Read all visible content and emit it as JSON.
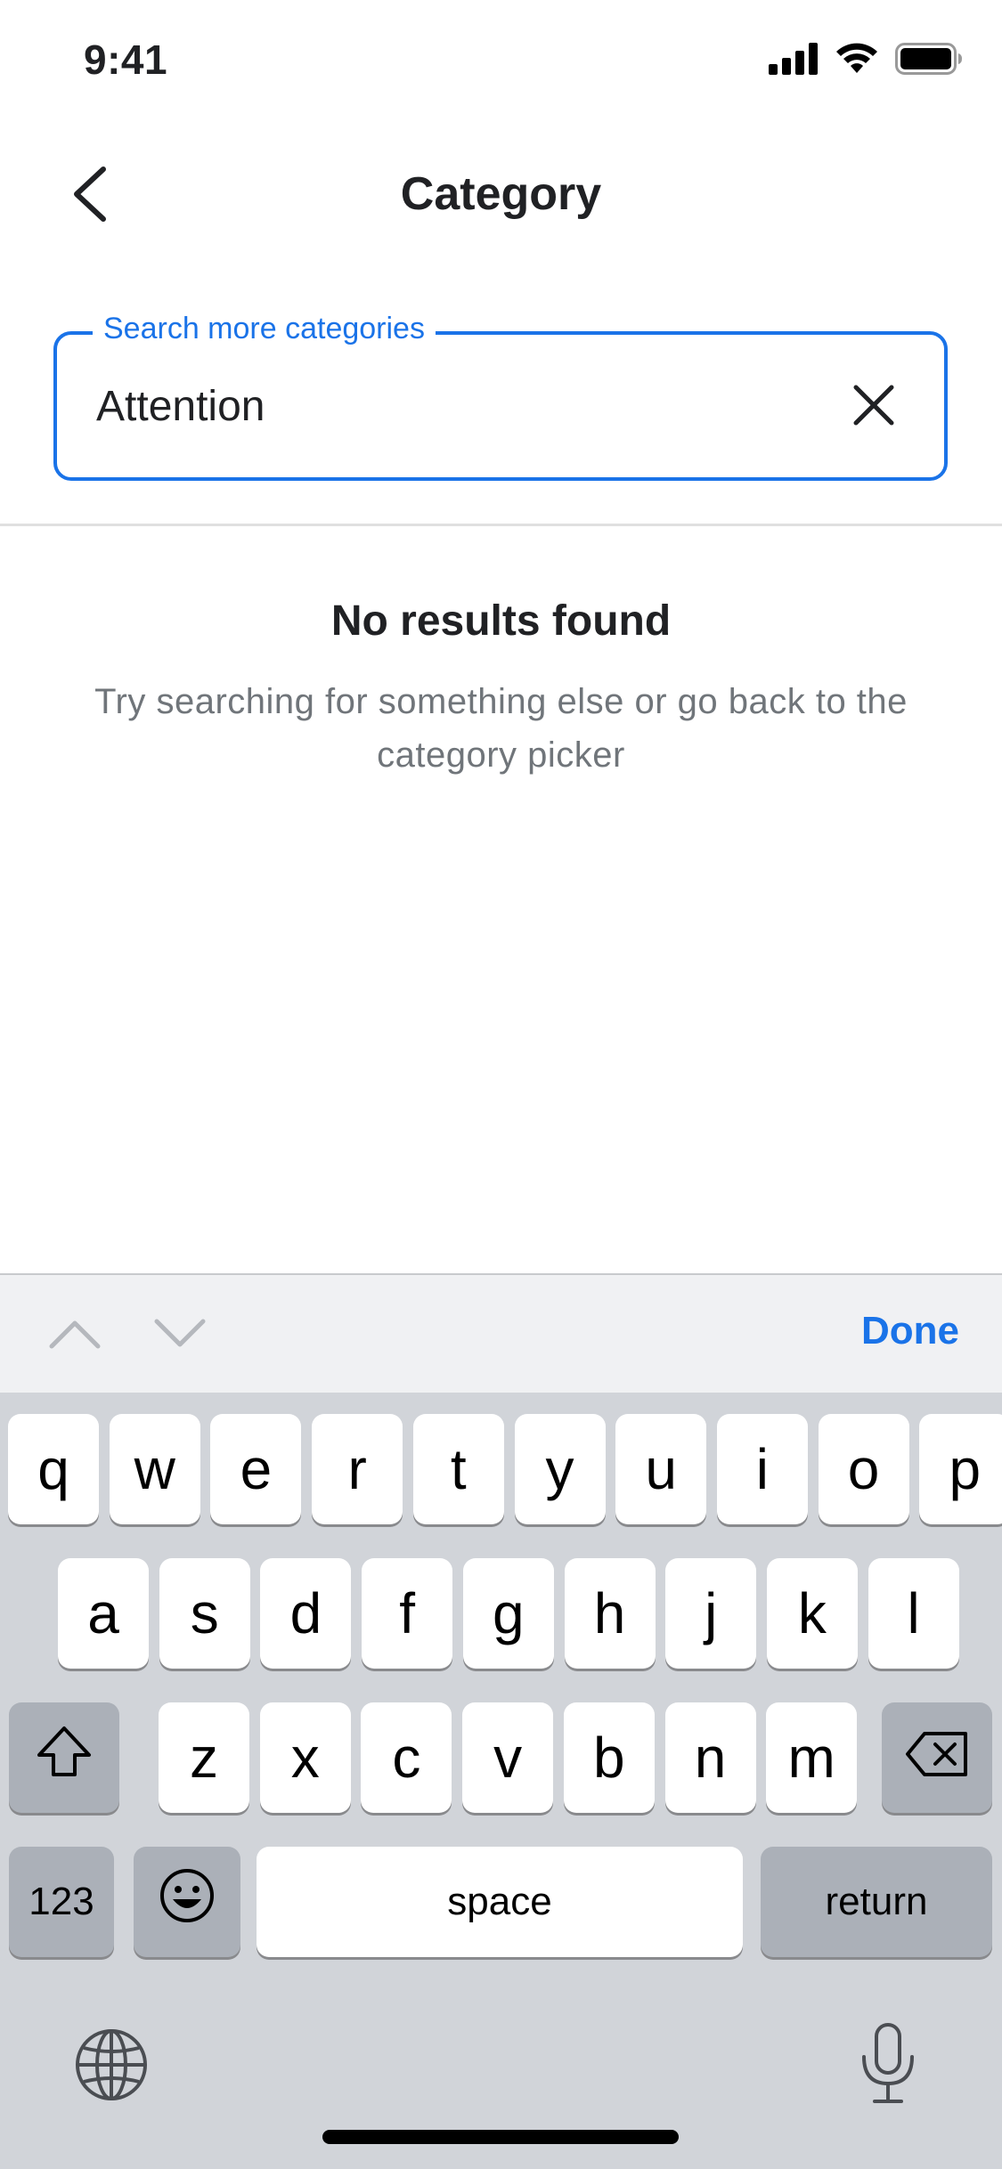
{
  "status_bar": {
    "time": "9:41",
    "icons": [
      "signal-icon",
      "wifi-icon",
      "battery-icon"
    ]
  },
  "header": {
    "title": "Category",
    "back_icon": "chevron-left-icon"
  },
  "search": {
    "label": "Search more categories",
    "value": "Attention",
    "clear_icon": "close-icon",
    "accent_color": "#1a73e8"
  },
  "empty_state": {
    "title": "No results found",
    "message": "Try searching for something else or go back to the category picker"
  },
  "accessory_bar": {
    "prev_icon": "chevron-up-icon",
    "next_icon": "chevron-down-icon",
    "done_label": "Done"
  },
  "keyboard": {
    "row1": [
      "q",
      "w",
      "e",
      "r",
      "t",
      "y",
      "u",
      "i",
      "o",
      "p"
    ],
    "row2": [
      "a",
      "s",
      "d",
      "f",
      "g",
      "h",
      "j",
      "k",
      "l"
    ],
    "row3": [
      "z",
      "x",
      "c",
      "v",
      "b",
      "n",
      "m"
    ],
    "numbers_label": "123",
    "space_label": "space",
    "return_label": "return",
    "shift_icon": "shift-icon",
    "delete_icon": "backspace-icon",
    "emoji_icon": "emoji-icon",
    "globe_icon": "globe-icon",
    "mic_icon": "microphone-icon"
  }
}
